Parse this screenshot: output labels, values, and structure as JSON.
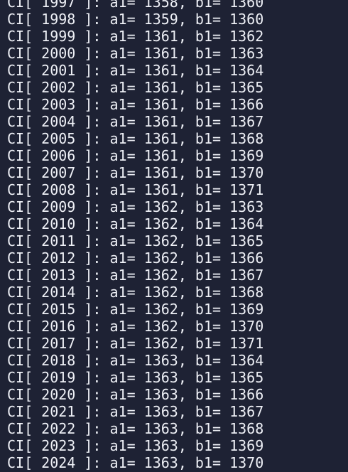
{
  "terminal": {
    "lines": [
      "CI[ 1997 ]: a1= 1358, b1= 1360",
      "CI[ 1998 ]: a1= 1359, b1= 1360",
      "CI[ 1999 ]: a1= 1361, b1= 1362",
      "CI[ 2000 ]: a1= 1361, b1= 1363",
      "CI[ 2001 ]: a1= 1361, b1= 1364",
      "CI[ 2002 ]: a1= 1361, b1= 1365",
      "CI[ 2003 ]: a1= 1361, b1= 1366",
      "CI[ 2004 ]: a1= 1361, b1= 1367",
      "CI[ 2005 ]: a1= 1361, b1= 1368",
      "CI[ 2006 ]: a1= 1361, b1= 1369",
      "CI[ 2007 ]: a1= 1361, b1= 1370",
      "CI[ 2008 ]: a1= 1361, b1= 1371",
      "CI[ 2009 ]: a1= 1362, b1= 1363",
      "CI[ 2010 ]: a1= 1362, b1= 1364",
      "CI[ 2011 ]: a1= 1362, b1= 1365",
      "CI[ 2012 ]: a1= 1362, b1= 1366",
      "CI[ 2013 ]: a1= 1362, b1= 1367",
      "CI[ 2014 ]: a1= 1362, b1= 1368",
      "CI[ 2015 ]: a1= 1362, b1= 1369",
      "CI[ 2016 ]: a1= 1362, b1= 1370",
      "CI[ 2017 ]: a1= 1362, b1= 1371",
      "CI[ 2018 ]: a1= 1363, b1= 1364",
      "CI[ 2019 ]: a1= 1363, b1= 1365",
      "CI[ 2020 ]: a1= 1363, b1= 1366",
      "CI[ 2021 ]: a1= 1363, b1= 1367",
      "CI[ 2022 ]: a1= 1363, b1= 1368",
      "CI[ 2023 ]: a1= 1363, b1= 1369",
      "CI[ 2024 ]: a1= 1363, b1= 1370"
    ],
    "colors": {
      "background": "#1e2234",
      "text": "#eef0f6"
    }
  }
}
